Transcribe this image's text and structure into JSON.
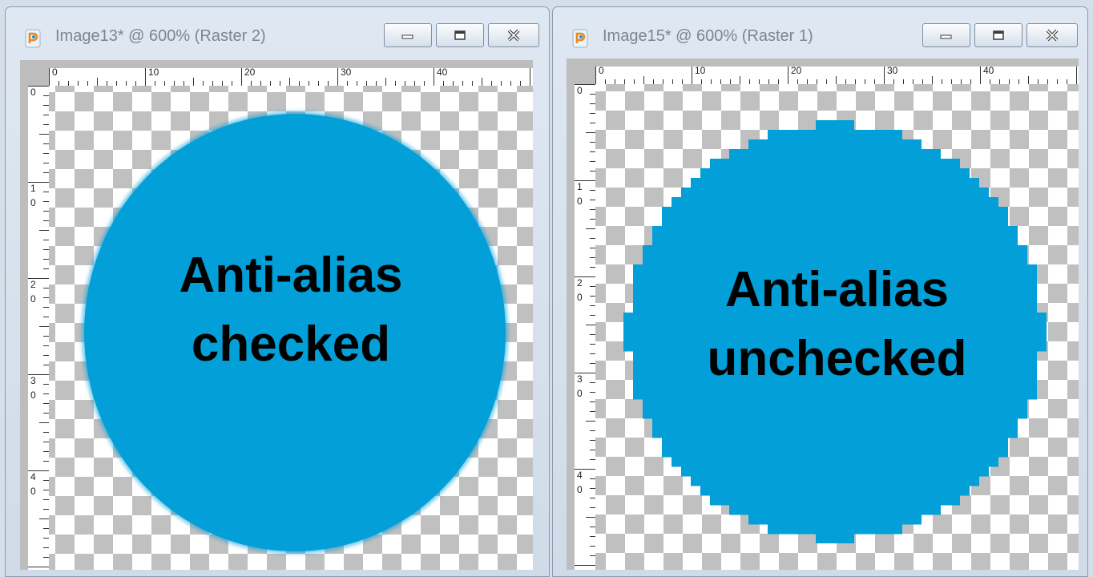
{
  "windows": [
    {
      "title": "Image13* @ 600% (Raster 2)",
      "ruler_h_labels": [
        "0",
        "10",
        "20",
        "30",
        "40"
      ],
      "ruler_v_labels": [
        [
          "0",
          ""
        ],
        [
          "1",
          "0"
        ],
        [
          "2",
          "0"
        ],
        [
          "3",
          "0"
        ],
        [
          "4",
          "0"
        ]
      ],
      "label_line1": "Anti-alias",
      "label_line2": "checked",
      "anti_alias": true
    },
    {
      "title": "Image15* @ 600% (Raster 1)",
      "ruler_h_labels": [
        "0",
        "10",
        "20",
        "30",
        "40"
      ],
      "ruler_v_labels": [
        [
          "0",
          ""
        ],
        [
          "1",
          "0"
        ],
        [
          "2",
          "0"
        ],
        [
          "3",
          "0"
        ],
        [
          "4",
          "0"
        ]
      ],
      "label_line1": "Anti-alias",
      "label_line2": "unchecked",
      "anti_alias": false
    }
  ],
  "colors": {
    "circle_fill": "#029fd8",
    "checker_dark": "#c0c0c0",
    "checker_light": "#ffffff"
  },
  "icons": {
    "app": "paintshop-pro-icon",
    "minimize": "minimize-icon",
    "maximize": "maximize-icon",
    "close": "close-icon"
  }
}
